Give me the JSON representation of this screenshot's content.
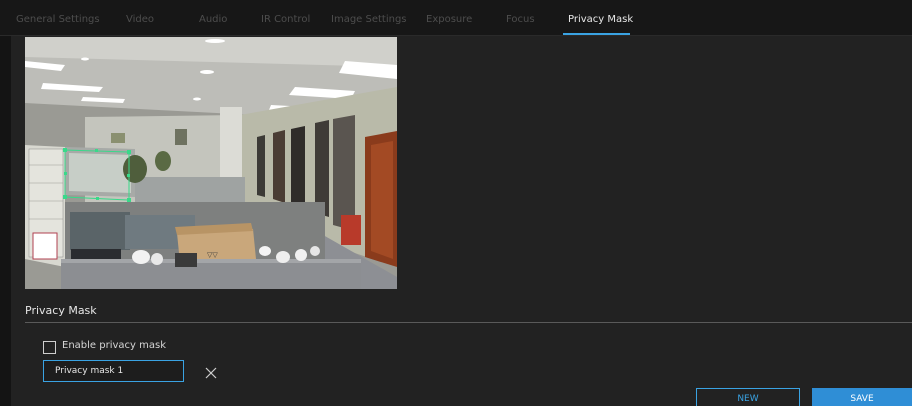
{
  "tabs": [
    {
      "label": "General Settings"
    },
    {
      "label": "Video"
    },
    {
      "label": "Audio"
    },
    {
      "label": "IR Control"
    },
    {
      "label": "Image Settings"
    },
    {
      "label": "Exposure"
    },
    {
      "label": "Focus"
    },
    {
      "label": "Privacy Mask",
      "active": true
    }
  ],
  "section": {
    "title": "Privacy Mask"
  },
  "enable_checkbox": {
    "label": "Enable privacy mask",
    "checked": false
  },
  "mask_field": {
    "value": "Privacy mask 1"
  },
  "buttons": {
    "new_label": "NEW",
    "save_label": "SAVE"
  },
  "icons": {
    "delete": "close-icon"
  },
  "colors": {
    "accent": "#3aa3e3",
    "save_button": "#2f8ed6",
    "background": "#222222",
    "mask_outline": "#39d98a"
  }
}
